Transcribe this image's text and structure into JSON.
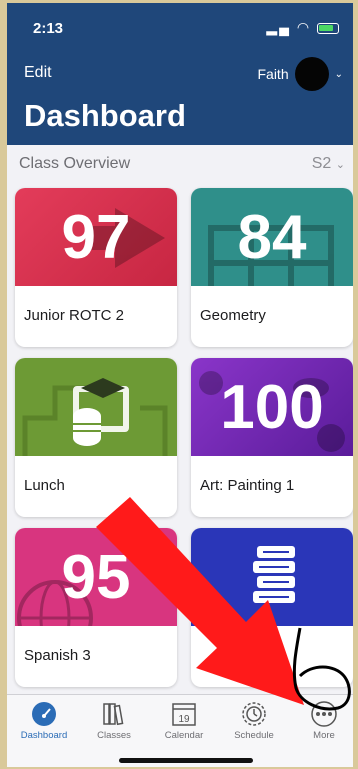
{
  "status": {
    "time": "2:13"
  },
  "header": {
    "edit_label": "Edit",
    "user_name": "Faith",
    "title": "Dashboard"
  },
  "overview": {
    "label": "Class Overview",
    "term": "S2"
  },
  "classes": [
    {
      "name": "Junior ROTC 2",
      "grade": "97",
      "color": "#d7304e"
    },
    {
      "name": "Geometry",
      "grade": "84",
      "color": "#2f8f8a"
    },
    {
      "name": "Lunch",
      "grade": "",
      "color": "#6d9a35"
    },
    {
      "name": "Art: Painting 1",
      "grade": "100",
      "color": "#7a2cbf"
    },
    {
      "name": "Spanish 3",
      "grade": "95",
      "color": "#d8357f"
    },
    {
      "name": "",
      "grade": "",
      "color": "#2a36b8"
    }
  ],
  "tabs": [
    {
      "label": "Dashboard",
      "icon": "dashboard-gauge-icon",
      "active": true
    },
    {
      "label": "Classes",
      "icon": "books-icon",
      "active": false
    },
    {
      "label": "Calendar",
      "icon": "calendar-icon",
      "day": "19",
      "active": false
    },
    {
      "label": "Schedule",
      "icon": "clock-icon",
      "active": false
    },
    {
      "label": "More",
      "icon": "ellipsis-icon",
      "active": false
    }
  ],
  "annotations": {
    "arrow_color": "#ff1a1a",
    "circle_color": "#000000"
  }
}
